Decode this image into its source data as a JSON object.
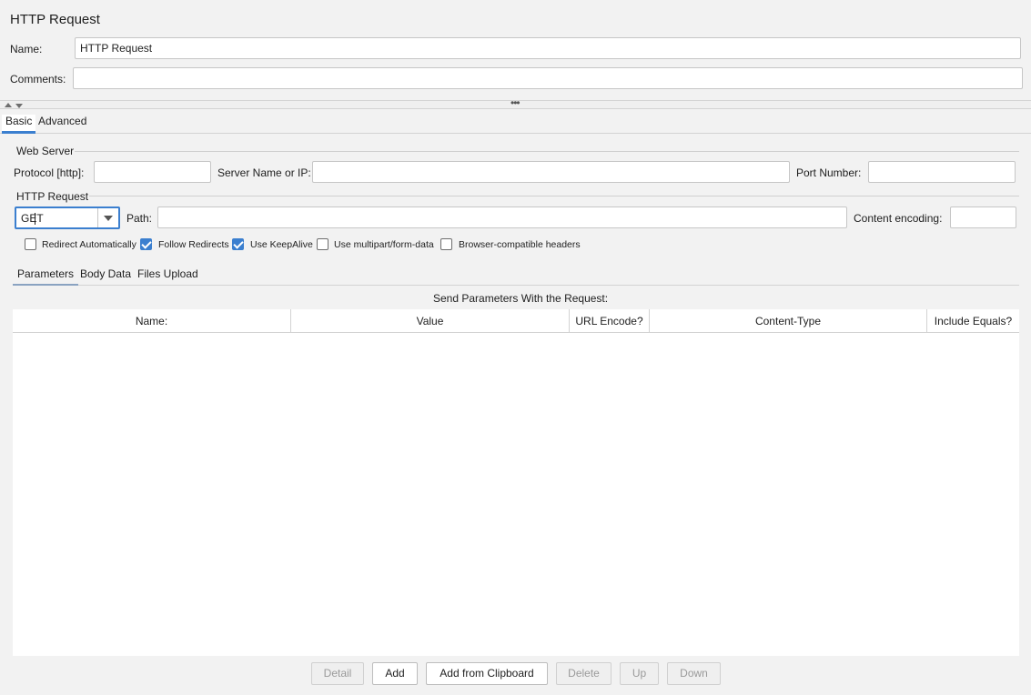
{
  "header": {
    "title": "HTTP Request",
    "name_label": "Name:",
    "name_value": "HTTP Request",
    "comments_label": "Comments:",
    "comments_value": ""
  },
  "tabs": [
    {
      "label": "Basic",
      "active": true
    },
    {
      "label": "Advanced",
      "active": false
    }
  ],
  "web_server": {
    "group_label": "Web Server",
    "protocol_label": "Protocol [http]:",
    "protocol_value": "",
    "server_label": "Server Name or IP:",
    "server_value": "",
    "port_label": "Port Number:",
    "port_value": ""
  },
  "http_request": {
    "group_label": "HTTP Request",
    "method": "GET",
    "path_label": "Path:",
    "path_value": "",
    "encoding_label": "Content encoding:",
    "encoding_value": ""
  },
  "options": [
    {
      "label": "Redirect Automatically",
      "checked": false
    },
    {
      "label": "Follow Redirects",
      "checked": true
    },
    {
      "label": "Use KeepAlive",
      "checked": true
    },
    {
      "label": "Use multipart/form-data",
      "checked": false
    },
    {
      "label": "Browser-compatible headers",
      "checked": false
    }
  ],
  "subtabs": [
    {
      "label": "Parameters",
      "active": true
    },
    {
      "label": "Body Data",
      "active": false
    },
    {
      "label": "Files Upload",
      "active": false
    }
  ],
  "params_table": {
    "caption": "Send Parameters With the Request:",
    "columns": [
      "Name:",
      "Value",
      "URL Encode?",
      "Content-Type",
      "Include Equals?"
    ],
    "rows": []
  },
  "buttons": [
    {
      "label": "Detail",
      "enabled": false
    },
    {
      "label": "Add",
      "enabled": true
    },
    {
      "label": "Add from Clipboard",
      "enabled": true
    },
    {
      "label": "Delete",
      "enabled": false
    },
    {
      "label": "Up",
      "enabled": false
    },
    {
      "label": "Down",
      "enabled": false
    }
  ],
  "colors": {
    "accent": "#3b7fcf",
    "background": "#f2f2f2",
    "border": "#c6c6c6"
  }
}
